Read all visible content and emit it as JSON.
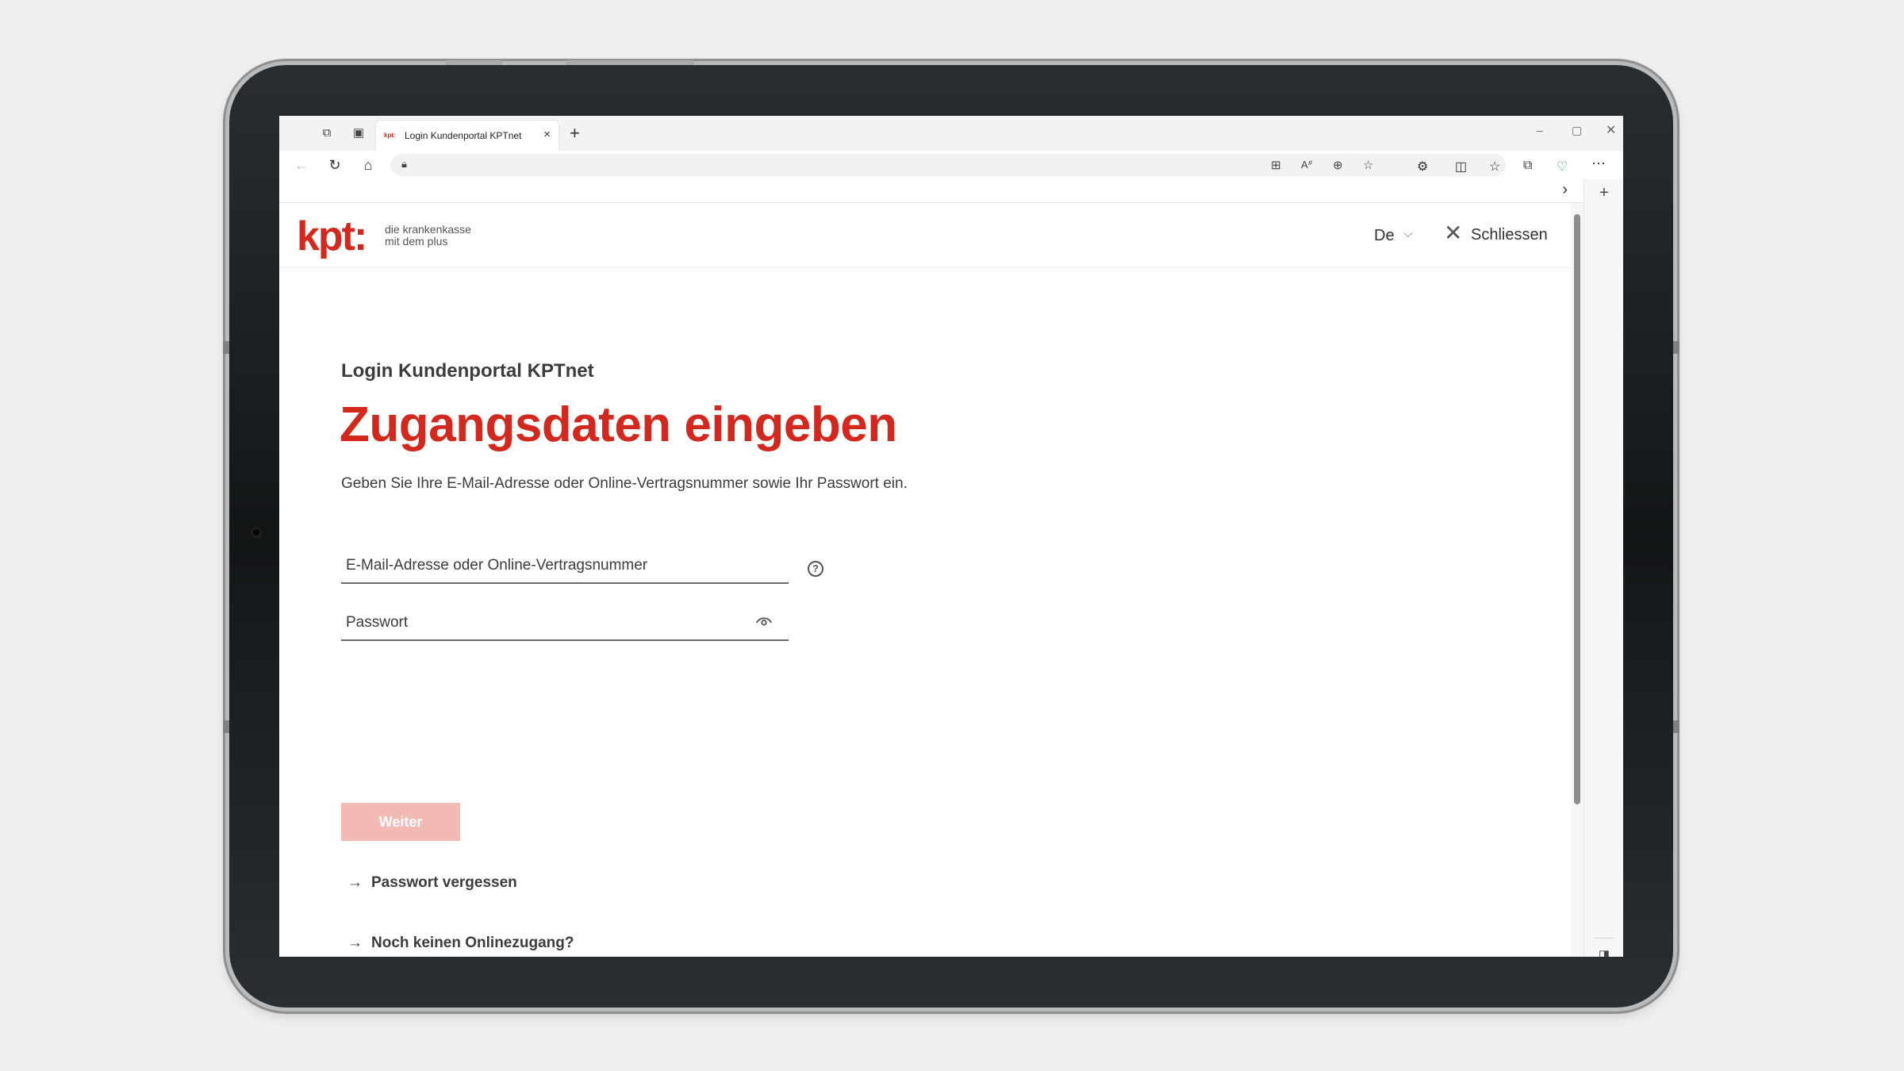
{
  "browser": {
    "tab_title": "Login Kundenportal KPTnet",
    "tab_favicon": "kpt:",
    "new_tab": "+",
    "tab_close": "×",
    "sidebar_add": "+"
  },
  "site": {
    "logo": "kpt:",
    "tagline_line1": "die krankenkasse",
    "tagline_line2": "mit dem plus",
    "language": "De",
    "language_chevron": "⌵",
    "close_label": "Schliessen"
  },
  "login": {
    "subtitle": "Login Kundenportal KPTnet",
    "title": "Zugangsdaten eingeben",
    "description": "Geben Sie Ihre E-Mail-Adresse oder Online-Vertragsnummer sowie Ihr Passwort ein.",
    "email_placeholder": "E-Mail-Adresse oder Online-Vertragsnummer",
    "email_value": "",
    "help_symbol": "?",
    "password_placeholder": "Passwort",
    "password_value": "",
    "submit_label": "Weiter",
    "link_arrow": "→",
    "forgot_password": "Passwort vergessen",
    "no_access": "Noch keinen Onlinezugang?"
  },
  "colors": {
    "brand_red": "#d3281e",
    "button_disabled": "#f3b9b5",
    "text": "#3c3c3c"
  },
  "icons": {
    "back": "arrow-left-icon",
    "reload": "reload-icon",
    "home": "home-icon",
    "lock": "lock-icon",
    "help": "question-circle-icon",
    "eye": "eye-icon",
    "close": "close-icon"
  }
}
